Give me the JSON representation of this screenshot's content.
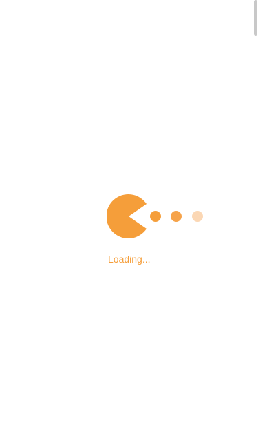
{
  "loading": {
    "text": "Loading...",
    "color": "#f59e3a",
    "dot_colors": [
      "#f59e3a",
      "#f6a34a",
      "#fbd7b4"
    ]
  },
  "icons": {
    "loader": "pacman-loader-icon"
  }
}
